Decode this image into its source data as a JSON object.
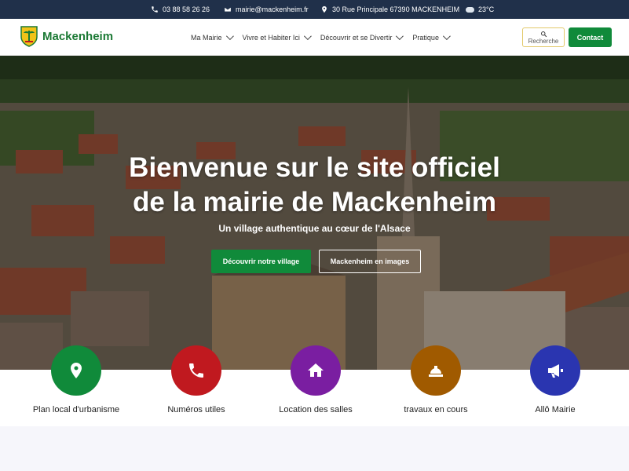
{
  "topbar": {
    "phone": "03 88 58 26 26",
    "email": "mairie@mackenheim.fr",
    "address": "30 Rue Principale 67390 MACKENHEIM",
    "weather": "23°C"
  },
  "header": {
    "site_name": "Mackenheim",
    "nav": [
      "Ma Mairie",
      "Vivre et Habiter Ici",
      "Découvrir et se Divertir",
      "Pratique"
    ],
    "search_label": "Recherche",
    "contact_label": "Contact"
  },
  "hero": {
    "title_line1": "Bienvenue sur le site officiel",
    "title_line2": "de la mairie de Mackenheim",
    "subtitle": "Un village authentique au cœur de l'Alsace",
    "primary_button": "Découvrir notre village",
    "secondary_button": "Mackenheim en images"
  },
  "quick_links": [
    {
      "label": "Plan local d'urbanisme",
      "icon": "map-pin-icon",
      "color": "#108a3a"
    },
    {
      "label": "Numéros utiles",
      "icon": "phone-icon",
      "color": "#c0191f"
    },
    {
      "label": "Location des salles",
      "icon": "house-icon",
      "color": "#7a1ea1"
    },
    {
      "label": "travaux en cours",
      "icon": "hard-hat-icon",
      "color": "#a05a00"
    },
    {
      "label": "Allô Mairie",
      "icon": "megaphone-icon",
      "color": "#2a35b0"
    }
  ],
  "colors": {
    "topbar": "#20304a",
    "brand_green": "#108a3a"
  }
}
